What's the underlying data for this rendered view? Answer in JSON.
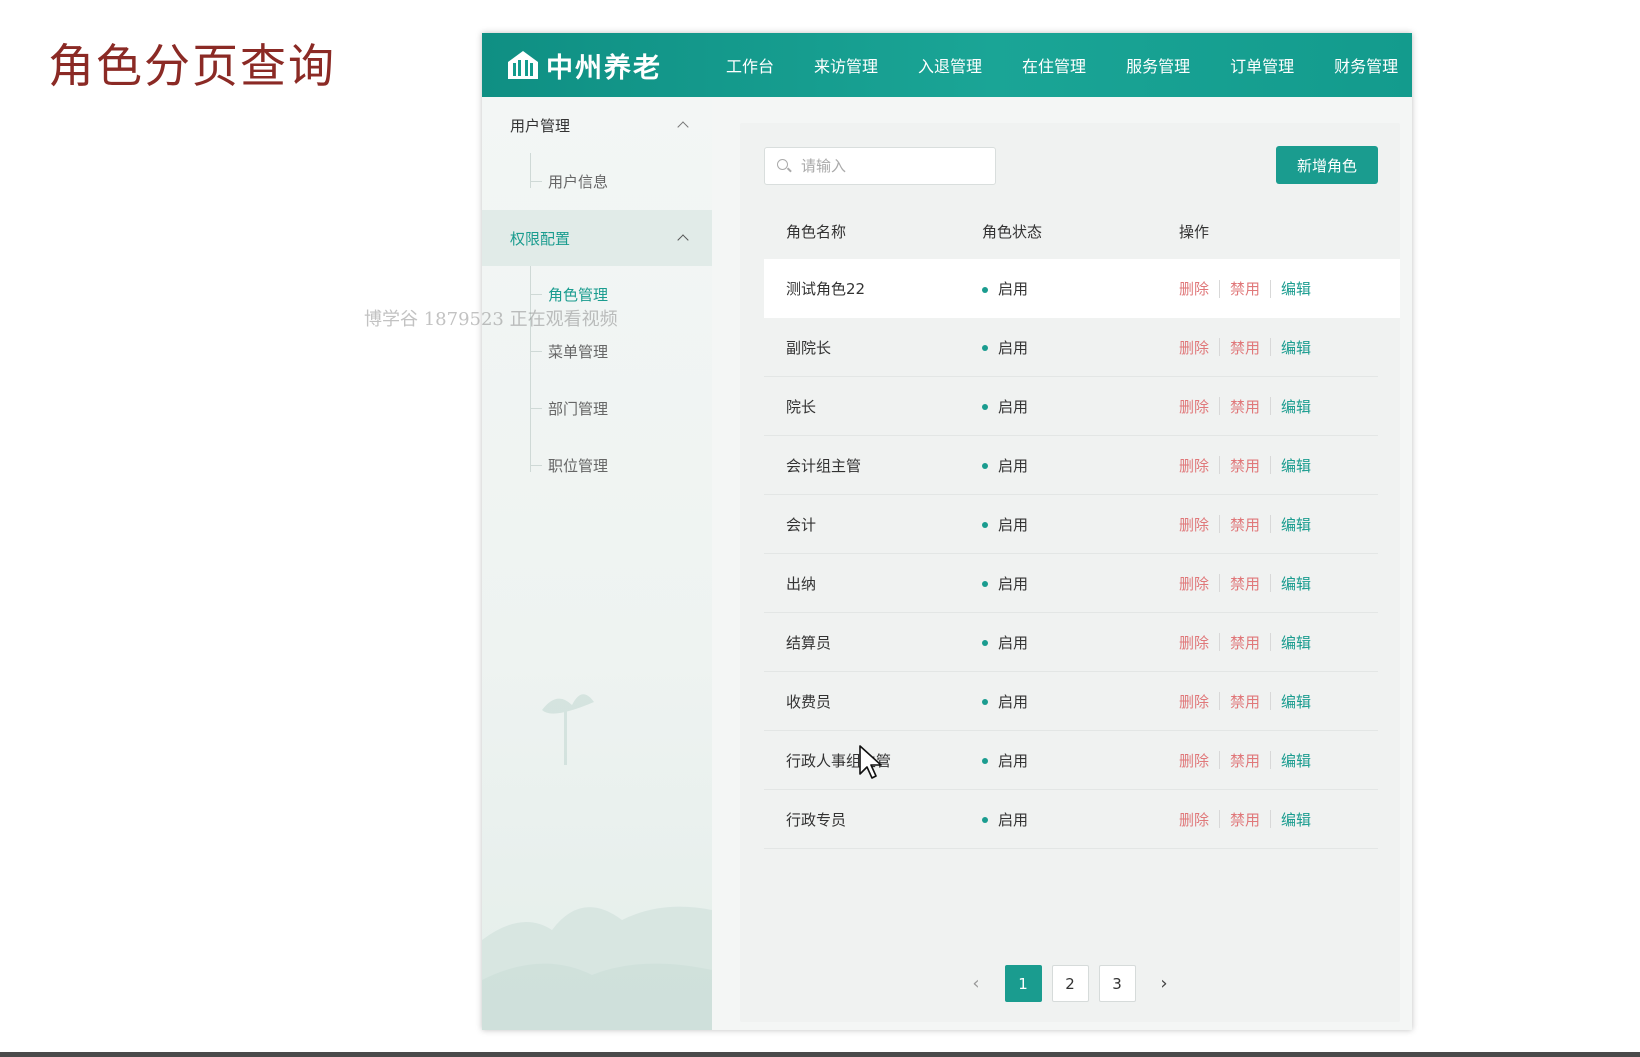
{
  "slide": {
    "title": "角色分页查询",
    "watermark": "博学谷 1879523 正在观看视频"
  },
  "header": {
    "logo_text": "中州养老",
    "nav": [
      "工作台",
      "来访管理",
      "入退管理",
      "在住管理",
      "服务管理",
      "订单管理",
      "财务管理"
    ]
  },
  "sidebar": {
    "groups": [
      {
        "label": "用户管理",
        "items": [
          "用户信息"
        ]
      },
      {
        "label": "权限配置",
        "items": [
          "角色管理",
          "菜单管理",
          "部门管理",
          "职位管理"
        ]
      }
    ]
  },
  "toolbar": {
    "search_placeholder": "请输入",
    "add_label": "新增角色"
  },
  "table": {
    "headers": [
      "角色名称",
      "角色状态",
      "操作"
    ],
    "rows": [
      {
        "name": "测试角色22",
        "status": "启用"
      },
      {
        "name": "副院长",
        "status": "启用"
      },
      {
        "name": "院长",
        "status": "启用"
      },
      {
        "name": "会计组主管",
        "status": "启用"
      },
      {
        "name": "会计",
        "status": "启用"
      },
      {
        "name": "出纳",
        "status": "启用"
      },
      {
        "name": "结算员",
        "status": "启用"
      },
      {
        "name": "收费员",
        "status": "启用"
      },
      {
        "name": "行政人事组主管",
        "status": "启用"
      },
      {
        "name": "行政专员",
        "status": "启用"
      }
    ],
    "ops": {
      "delete": "删除",
      "disable": "禁用",
      "edit": "编辑"
    }
  },
  "pagination": {
    "prev": "‹",
    "pages": [
      "1",
      "2",
      "3"
    ],
    "current": "1",
    "next": "›"
  },
  "colors": {
    "primary": "#1a9c8f",
    "danger": "#e0787a",
    "title": "#8b2a25"
  }
}
